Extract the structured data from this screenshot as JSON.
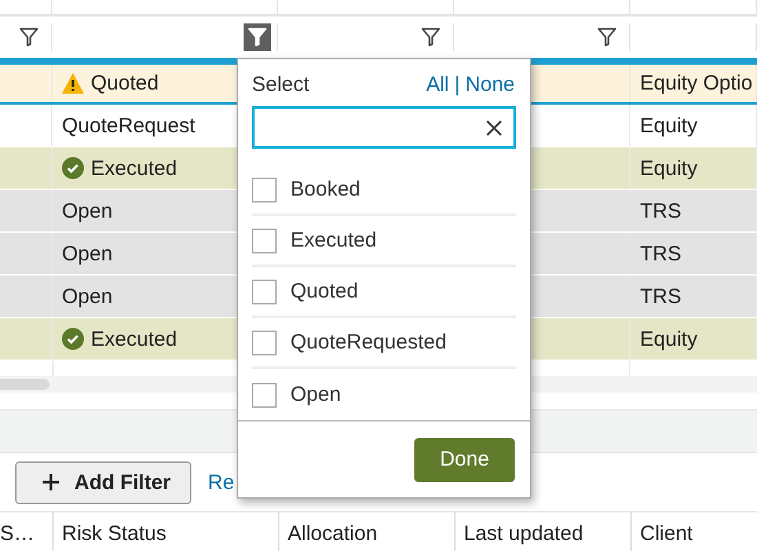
{
  "filter_row": [
    {
      "active": false
    },
    {
      "active": true
    },
    {
      "active": false
    },
    {
      "active": false
    }
  ],
  "rows": [
    {
      "kind": "quoted",
      "selected": true,
      "status": "Quoted",
      "product": "Equity Optio"
    },
    {
      "kind": "plain",
      "selected": false,
      "status": "QuoteRequest",
      "product": "Equity"
    },
    {
      "kind": "executed",
      "selected": false,
      "status": "Executed",
      "product": "Equity"
    },
    {
      "kind": "open",
      "selected": false,
      "status": "Open",
      "product": "TRS"
    },
    {
      "kind": "open",
      "selected": false,
      "status": "Open",
      "product": "TRS"
    },
    {
      "kind": "open",
      "selected": false,
      "status": "Open",
      "product": "TRS"
    },
    {
      "kind": "executed",
      "selected": false,
      "status": "Executed",
      "product": "Equity"
    }
  ],
  "toolbar": {
    "add_filter": "Add Filter",
    "link": "Re"
  },
  "columns": [
    "S…",
    "Risk Status",
    "Allocation",
    "Last updated",
    "Client"
  ],
  "filter_popup": {
    "title": "Select",
    "all": "All",
    "separator": "|",
    "none": "None",
    "options": [
      {
        "label": "Booked",
        "checked": false
      },
      {
        "label": "Executed",
        "checked": false
      },
      {
        "label": "Quoted",
        "checked": false
      },
      {
        "label": "QuoteRequested",
        "checked": false
      },
      {
        "label": "Open",
        "checked": false
      }
    ],
    "done": "Done"
  }
}
